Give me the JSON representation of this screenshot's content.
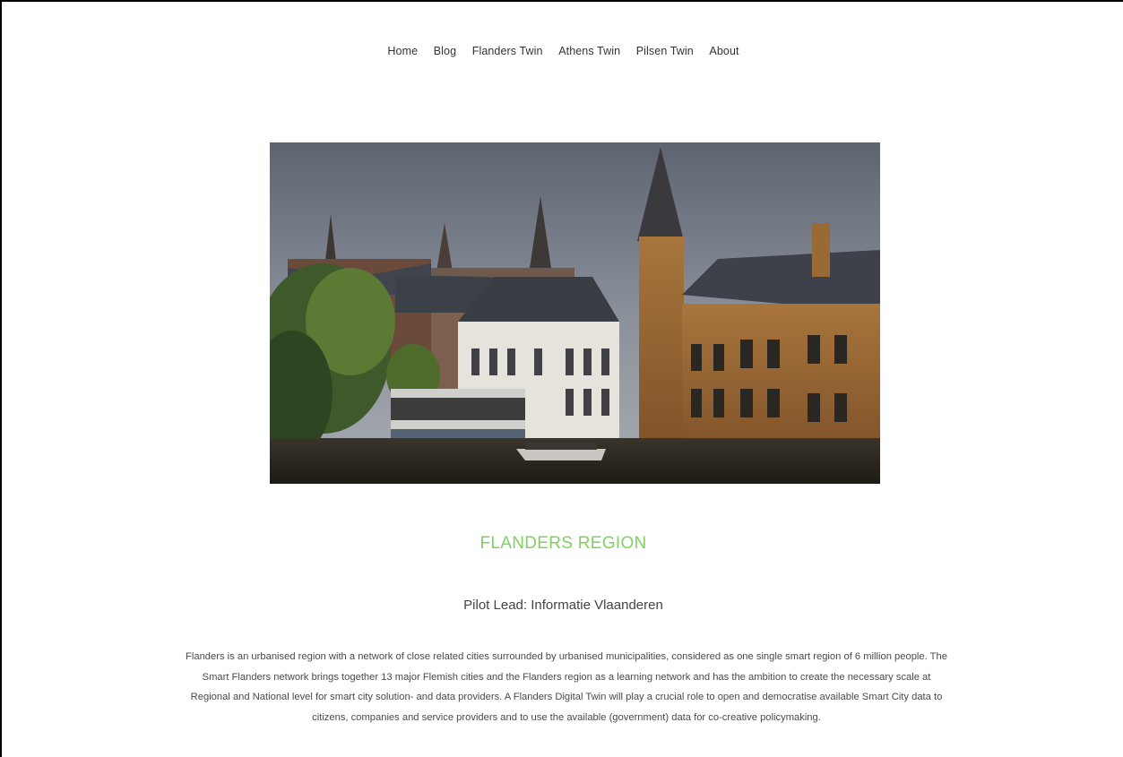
{
  "nav": {
    "items": [
      "Home",
      "Blog",
      "Flanders Twin",
      "Athens Twin",
      "Pilsen Twin",
      "About"
    ]
  },
  "hero": {
    "icon": "canal-buildings-photo"
  },
  "section": {
    "title": "FLANDERS REGION",
    "subtitle": "Pilot Lead: Informatie Vlaanderen",
    "body": "Flanders is an urbanised region with a network of close related cities surrounded by urbanised municipalities, considered as one single smart region of 6 million people. The Smart Flanders network brings together 13 major Flemish cities and the Flanders region as a learning network and has the ambition to create the necessary scale at Regional and National level for smart city solution- and data providers. A Flanders Digital Twin will play a crucial role to open and democratise available Smart City data to citizens, companies and service providers and to use the available (government) data for co-creative policymaking."
  },
  "colors": {
    "accent": "#7fd160",
    "text": "#3b3b3b"
  }
}
